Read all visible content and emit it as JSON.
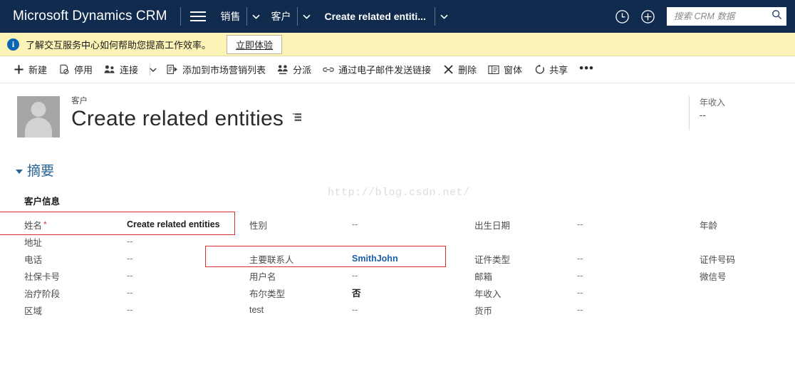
{
  "app": {
    "brand": "Microsoft Dynamics CRM",
    "accent_color": "#102b4e",
    "link_color": "#1a5faa",
    "highlight_color": "#d6302f"
  },
  "topnav": {
    "menu_icon": "hamburger-icon",
    "breadcrumbs": [
      {
        "label": "销售",
        "has_caret": true
      },
      {
        "label": "客户",
        "has_caret": true
      },
      {
        "label": "Create related entiti...",
        "has_caret": true
      }
    ],
    "clock_icon": "recent-clock-icon",
    "add_icon": "quick-create-plus-icon",
    "search": {
      "placeholder": "搜索 CRM 数据",
      "value": "",
      "icon": "search-icon"
    }
  },
  "notification": {
    "icon": "info-icon",
    "message": "了解交互服务中心如何帮助您提高工作效率。",
    "action_label": "立即体验"
  },
  "commandbar": {
    "items": [
      {
        "label": "新建",
        "icon": "plus-icon",
        "caret": false
      },
      {
        "label": "停用",
        "icon": "deactivate-icon",
        "caret": false
      },
      {
        "label": "连接",
        "icon": "connect-people-icon",
        "caret": true
      },
      {
        "label": "添加到市场营销列表",
        "icon": "marketing-list-icon",
        "caret": false
      },
      {
        "label": "分派",
        "icon": "assign-people-icon",
        "caret": false
      },
      {
        "label": "通过电子邮件发送链接",
        "icon": "email-link-icon",
        "caret": false
      },
      {
        "label": "删除",
        "icon": "delete-x-icon",
        "caret": false
      },
      {
        "label": "窗体",
        "icon": "form-icon",
        "caret": false
      },
      {
        "label": "共享",
        "icon": "share-icon",
        "caret": false
      }
    ],
    "overflow_label": "•••"
  },
  "record": {
    "entity_label": "客户",
    "title": "Create related entities",
    "avatar_icon": "person-placeholder-avatar",
    "form_selector_icon": "form-selector-icon",
    "header_stat": {
      "label": "年收入",
      "value": "--"
    }
  },
  "section": {
    "title": "摘要",
    "collapse_icon": "triangle-collapse-icon",
    "subsection_title": "客户信息"
  },
  "fields": {
    "rows": [
      [
        {
          "label": "姓名",
          "required": true,
          "value": "Create related entities",
          "style": "bold"
        },
        {
          "label": "性别",
          "required": false,
          "value": "--",
          "style": "muted"
        },
        {
          "label": "出生日期",
          "required": false,
          "value": "--",
          "style": "muted"
        },
        {
          "label": "年龄",
          "required": false,
          "value": "",
          "style": "muted"
        }
      ],
      [
        {
          "label": "地址",
          "required": false,
          "value": "--",
          "style": "muted"
        },
        {
          "label": "",
          "required": false,
          "value": "",
          "style": "muted"
        },
        {
          "label": "",
          "required": false,
          "value": "",
          "style": "muted"
        },
        {
          "label": "",
          "required": false,
          "value": "",
          "style": "muted"
        }
      ],
      [
        {
          "label": "电话",
          "required": false,
          "value": "--",
          "style": "muted"
        },
        {
          "label": "主要联系人",
          "required": false,
          "value": "SmithJohn",
          "style": "link"
        },
        {
          "label": "证件类型",
          "required": false,
          "value": "--",
          "style": "muted"
        },
        {
          "label": "证件号码",
          "required": false,
          "value": "",
          "style": "muted"
        }
      ],
      [
        {
          "label": "社保卡号",
          "required": false,
          "value": "--",
          "style": "muted"
        },
        {
          "label": "用户名",
          "required": false,
          "value": "--",
          "style": "muted"
        },
        {
          "label": "邮箱",
          "required": false,
          "value": "--",
          "style": "muted"
        },
        {
          "label": "微信号",
          "required": false,
          "value": "",
          "style": "muted"
        }
      ],
      [
        {
          "label": "治疗阶段",
          "required": false,
          "value": "--",
          "style": "muted"
        },
        {
          "label": "布尔类型",
          "required": false,
          "value": "否",
          "style": "bold"
        },
        {
          "label": "年收入",
          "required": false,
          "value": "--",
          "style": "muted"
        },
        {
          "label": "",
          "required": false,
          "value": "",
          "style": "muted"
        }
      ],
      [
        {
          "label": "区域",
          "required": false,
          "value": "--",
          "style": "muted"
        },
        {
          "label": "test",
          "required": false,
          "value": "--",
          "style": "muted"
        },
        {
          "label": "货币",
          "required": false,
          "value": "--",
          "style": "muted"
        },
        {
          "label": "",
          "required": false,
          "value": "",
          "style": "muted"
        }
      ]
    ]
  },
  "watermark": "http://blog.csdn.net/"
}
